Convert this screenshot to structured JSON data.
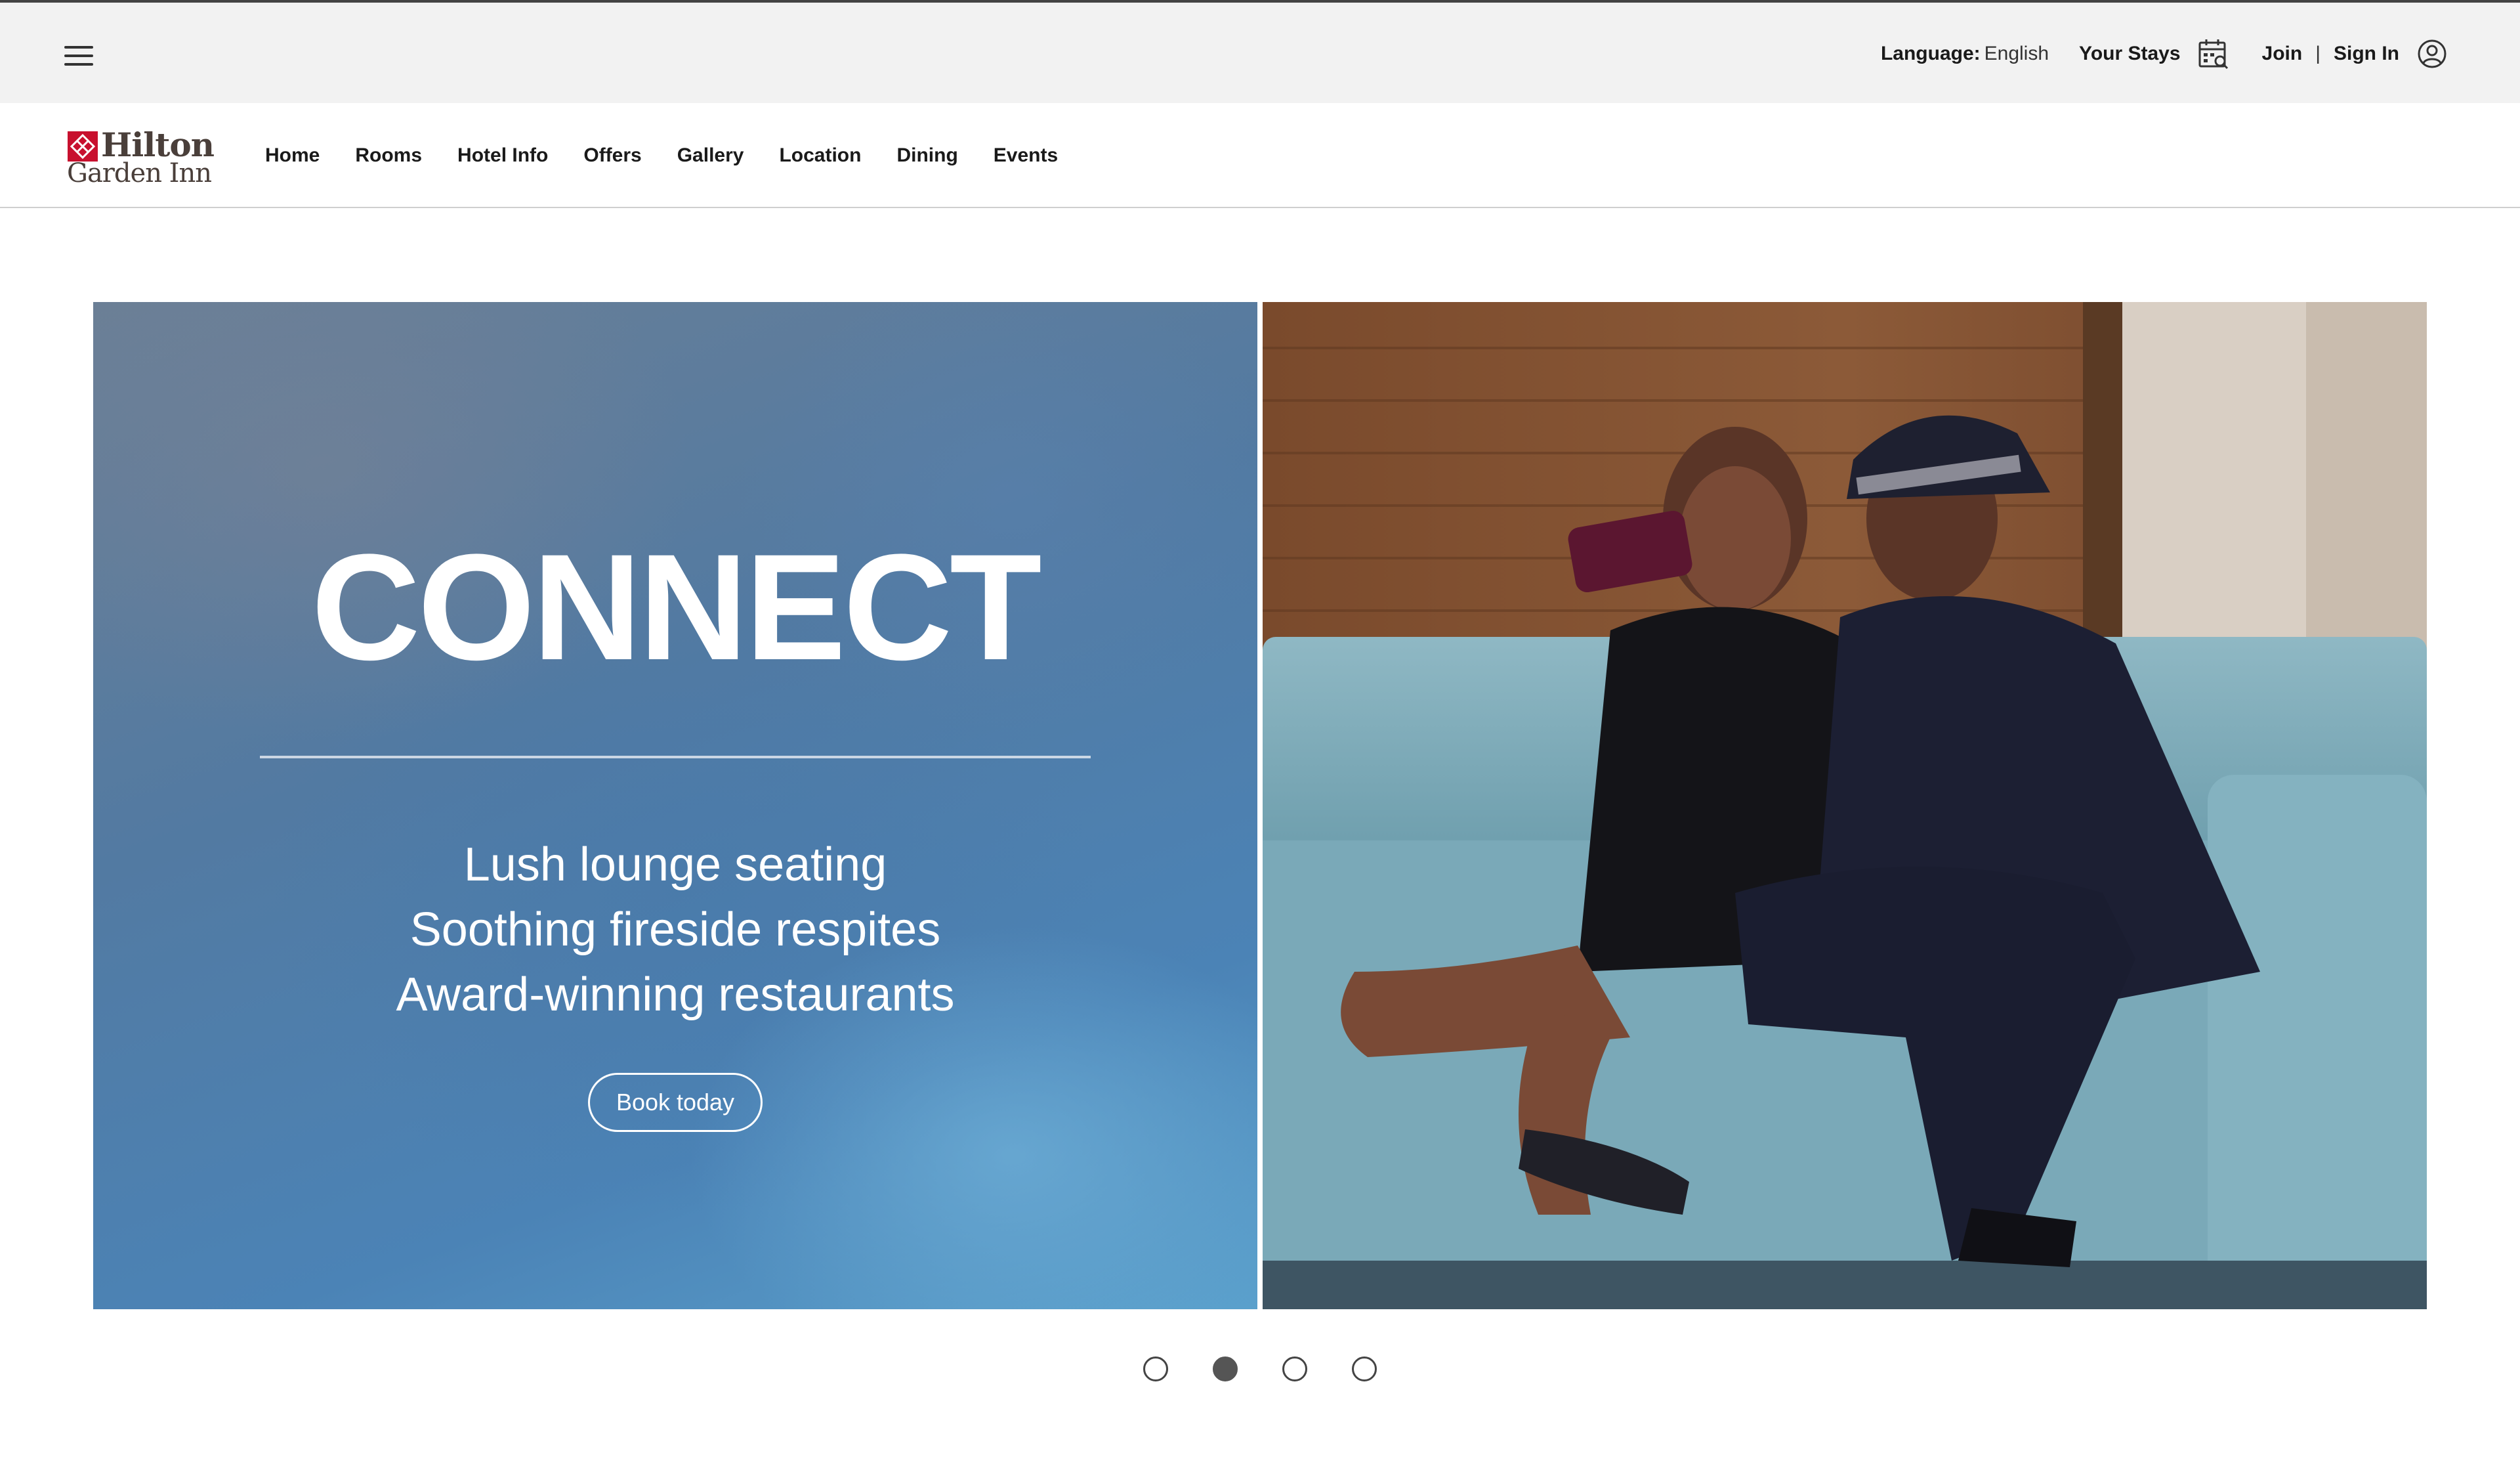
{
  "utility_bar": {
    "language_label": "Language:",
    "language_value": "English",
    "your_stays": "Your Stays",
    "join": "Join",
    "divider": "|",
    "sign_in": "Sign In"
  },
  "brand": {
    "logo_line1": "Hilton",
    "logo_line2": "Garden Inn",
    "brand_color": "#c8102e"
  },
  "nav": {
    "items": [
      {
        "label": "Home"
      },
      {
        "label": "Rooms"
      },
      {
        "label": "Hotel Info"
      },
      {
        "label": "Offers"
      },
      {
        "label": "Gallery"
      },
      {
        "label": "Location"
      },
      {
        "label": "Dining"
      },
      {
        "label": "Events"
      }
    ]
  },
  "hero": {
    "title": "CONNECT",
    "lines": [
      "Lush lounge seating",
      "Soothing fireside respites",
      "Award-winning restaurants"
    ],
    "cta": "Book today",
    "panel_color": "#4f80b0"
  },
  "carousel": {
    "slide_count": 4,
    "active_index": 1
  },
  "icons": {
    "menu": "hamburger-menu-icon",
    "stays": "calendar-search-icon",
    "account": "user-account-icon"
  }
}
